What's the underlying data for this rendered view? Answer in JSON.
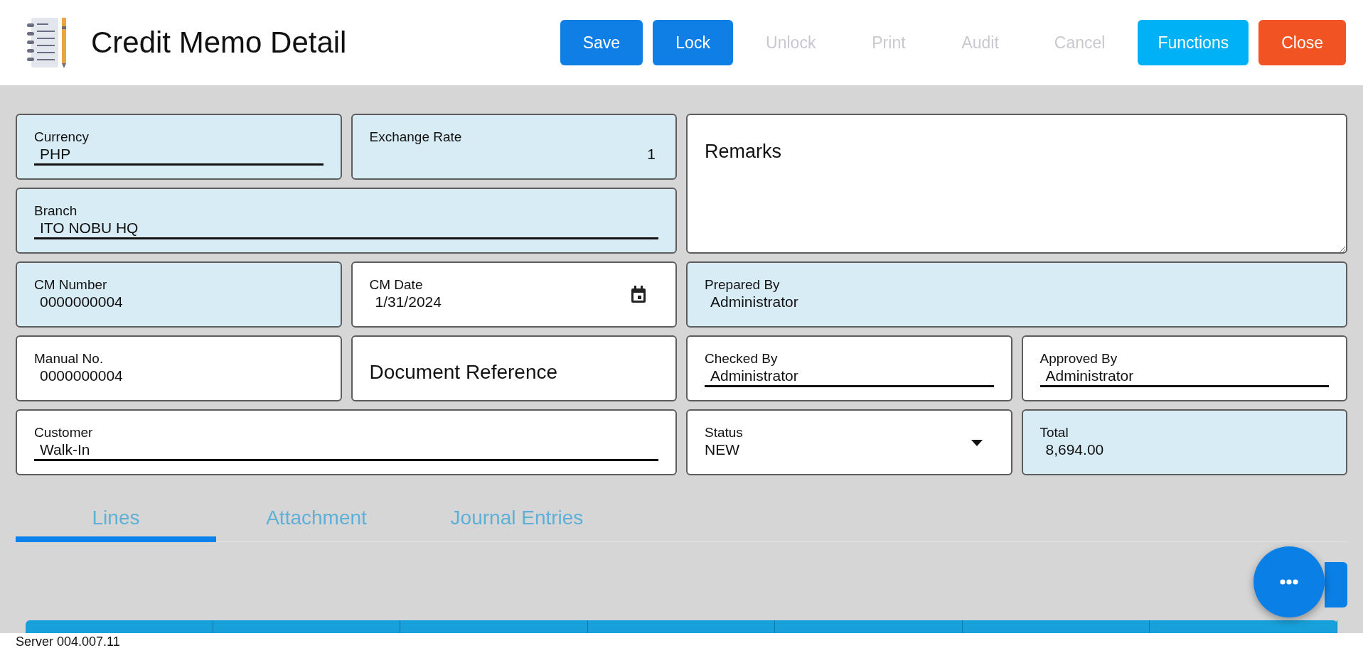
{
  "header": {
    "title": "Credit Memo Detail"
  },
  "buttons": [
    {
      "label": "Save",
      "kind": "primary",
      "disabled": false
    },
    {
      "label": "Lock",
      "kind": "primary",
      "disabled": false
    },
    {
      "label": "Unlock",
      "kind": "plain",
      "disabled": true
    },
    {
      "label": "Print",
      "kind": "plain",
      "disabled": true
    },
    {
      "label": "Audit",
      "kind": "plain",
      "disabled": true
    },
    {
      "label": "Cancel",
      "kind": "plain",
      "disabled": true
    },
    {
      "label": "Functions",
      "kind": "info",
      "disabled": false
    },
    {
      "label": "Close",
      "kind": "danger",
      "disabled": false
    }
  ],
  "fields": [
    {
      "kind": "text",
      "label": "Currency",
      "value": "PHP",
      "readonly": true,
      "underline": true
    },
    {
      "kind": "number",
      "label": "Exchange Rate",
      "value": "1",
      "readonly": true,
      "underline": false
    },
    {
      "kind": "textarea",
      "placeholder": "Remarks",
      "readonly": false
    },
    {
      "kind": "text",
      "label": "Branch",
      "value": "ITO NOBU HQ",
      "readonly": true,
      "underline": true
    },
    {
      "kind": "text",
      "label": "CM Number",
      "value": "0000000004",
      "readonly": true,
      "underline": false
    },
    {
      "kind": "date",
      "label": "CM Date",
      "value": "1/31/2024",
      "readonly": false,
      "underline": false
    },
    {
      "kind": "text",
      "label": "Prepared By",
      "value": "Administrator",
      "readonly": true,
      "underline": false
    },
    {
      "kind": "text",
      "label": "Manual No.",
      "value": "0000000004",
      "readonly": false,
      "underline": false
    },
    {
      "kind": "input",
      "placeholder": "Document Reference",
      "readonly": false
    },
    {
      "kind": "text",
      "label": "Checked By",
      "value": "Administrator",
      "readonly": false,
      "underline": true
    },
    {
      "kind": "text",
      "label": "Approved By",
      "value": "Administrator",
      "readonly": false,
      "underline": true
    },
    {
      "kind": "text",
      "label": "Customer",
      "value": "Walk-In",
      "readonly": false,
      "underline": true
    },
    {
      "kind": "select",
      "label": "Status",
      "value": "NEW",
      "readonly": false,
      "underline": false
    },
    {
      "kind": "text",
      "label": "Total",
      "value": "8,694.00",
      "readonly": true,
      "underline": false
    }
  ],
  "tabs": [
    {
      "label": "Lines",
      "selected": true
    },
    {
      "label": "Attachment",
      "selected": false
    },
    {
      "label": "Journal Entries",
      "selected": false
    }
  ],
  "status_bar": {
    "text": "Server 004.007.11"
  }
}
